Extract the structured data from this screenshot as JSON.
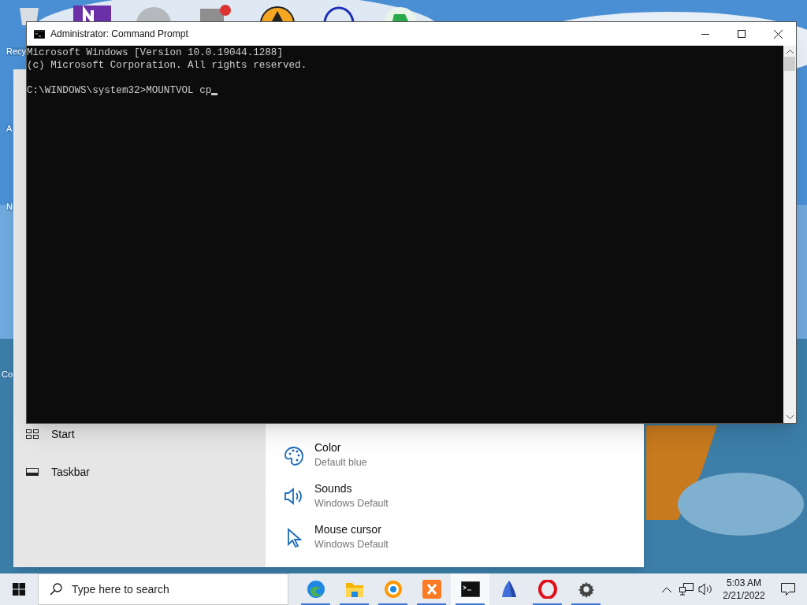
{
  "desktop_icons": [
    {
      "label": "Recy"
    },
    {
      "label": "A"
    },
    {
      "label": "N"
    },
    {
      "label": "Co"
    }
  ],
  "settings_window": {
    "nav_items": [
      {
        "kind": "start",
        "label": "Start"
      },
      {
        "kind": "taskbar",
        "label": "Taskbar"
      }
    ],
    "items": [
      {
        "kind": "color",
        "title": "Color",
        "subtitle": "Default blue"
      },
      {
        "kind": "sounds",
        "title": "Sounds",
        "subtitle": "Windows Default"
      },
      {
        "kind": "cursor",
        "title": "Mouse cursor",
        "subtitle": "Windows Default"
      }
    ]
  },
  "cmd_window": {
    "title": "Administrator: Command Prompt",
    "output": [
      "Microsoft Windows [Version 10.0.19044.1288]",
      "(c) Microsoft Corporation. All rights reserved."
    ],
    "prompt": "C:\\WINDOWS\\system32>MOUNTVOL cp"
  },
  "taskbar": {
    "search_placeholder": "Type here to search",
    "apps": [
      {
        "kind": "edge",
        "running": true,
        "selected": false
      },
      {
        "kind": "folder",
        "running": true,
        "selected": false
      },
      {
        "kind": "browser",
        "running": true,
        "selected": false
      },
      {
        "kind": "xampp",
        "running": true,
        "selected": false
      },
      {
        "kind": "terminal",
        "running": true,
        "selected": true
      },
      {
        "kind": "sail",
        "running": false,
        "selected": false
      },
      {
        "kind": "opera",
        "running": true,
        "selected": false
      },
      {
        "kind": "settings",
        "running": true,
        "selected": false
      }
    ],
    "time": "5:03 AM",
    "date": "2/21/2022"
  }
}
